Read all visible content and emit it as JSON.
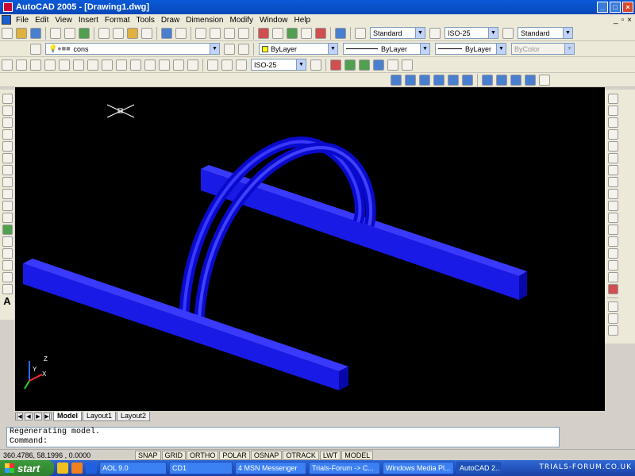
{
  "window": {
    "title": "AutoCAD 2005 - [Drawing1.dwg]"
  },
  "menu": [
    "File",
    "Edit",
    "View",
    "Insert",
    "Format",
    "Tools",
    "Draw",
    "Dimension",
    "Modify",
    "Window",
    "Help"
  ],
  "styles_toolbar": {
    "text_style": "Standard",
    "dim_style": "ISO-25",
    "table_style": "Standard"
  },
  "layers_toolbar": {
    "layer": "cons",
    "color": "ByLayer",
    "linetype": "ByLayer",
    "lineweight": "ByLayer",
    "plotstyle": "ByColor"
  },
  "dim_toolbar": {
    "dim_style": "ISO-25"
  },
  "layout_tabs": [
    "Model",
    "Layout1",
    "Layout2"
  ],
  "command_line": {
    "line1": "Regenerating model.",
    "line2": "Command:"
  },
  "status": {
    "coords": "360.4786, 58.1996 , 0.0000",
    "buttons": [
      "SNAP",
      "GRID",
      "ORTHO",
      "POLAR",
      "OSNAP",
      "OTRACK",
      "LWT",
      "MODEL"
    ]
  },
  "taskbar": {
    "start": "start",
    "items": [
      "AOL 9.0",
      "CD1",
      "4 MSN Messenger",
      "Trials-Forum -> C...",
      "Windows Media Pl...",
      "AutoCAD 2..."
    ],
    "watermark": "TRIALS-FORUM.CO.UK"
  }
}
